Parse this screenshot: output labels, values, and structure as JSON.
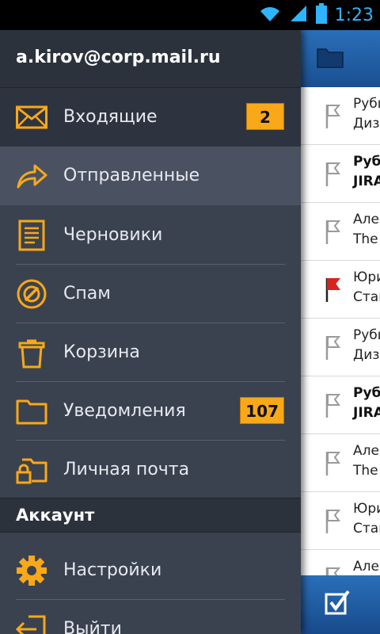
{
  "status_bar": {
    "time": "1:23",
    "icons": [
      "wifi-icon",
      "signal-icon",
      "battery-icon"
    ]
  },
  "drawer": {
    "account_email": "a.kirov@corp.mail.ru",
    "items": [
      {
        "label": "Входящие",
        "badge": "2",
        "icon": "envelope-icon"
      },
      {
        "label": "Отправленные",
        "badge": "",
        "icon": "sent-arrow-icon"
      },
      {
        "label": "Черновики",
        "badge": "",
        "icon": "document-icon"
      },
      {
        "label": "Спам",
        "badge": "",
        "icon": "spam-icon"
      },
      {
        "label": "Корзина",
        "badge": "",
        "icon": "trash-icon"
      },
      {
        "label": "Уведомления",
        "badge": "107",
        "icon": "folder-icon"
      },
      {
        "label": "Личная почта",
        "badge": "",
        "icon": "locked-folder-icon"
      }
    ],
    "section_title": "Аккаунт",
    "account_items": [
      {
        "label": "Настройки",
        "icon": "gear-icon"
      },
      {
        "label": "Выйти",
        "icon": "logout-icon"
      }
    ]
  },
  "message_list": {
    "messages": [
      {
        "line1": "Рубц",
        "line2": "Дизa",
        "bold": false,
        "flagged": false
      },
      {
        "line1": "Рубц",
        "line2": "JIRA",
        "bold": true,
        "flagged": false
      },
      {
        "line1": "Алек",
        "line2": "The",
        "bold": false,
        "flagged": false
      },
      {
        "line1": "Юри",
        "line2": "Стан",
        "bold": false,
        "flagged": true
      },
      {
        "line1": "Рубц",
        "line2": "Дизa",
        "bold": false,
        "flagged": false
      },
      {
        "line1": "Рубц",
        "line2": "JIRA",
        "bold": true,
        "flagged": false
      },
      {
        "line1": "Алек",
        "line2": "The",
        "bold": false,
        "flagged": false
      },
      {
        "line1": "Юри",
        "line2": "Стан",
        "bold": false,
        "flagged": false
      },
      {
        "line1": "Алек",
        "line2": "",
        "bold": false,
        "flagged": false
      }
    ]
  },
  "colors": {
    "accent": "#f8a818",
    "drawer_bg": "#3a4250",
    "header_blue": "#1a4f92",
    "flag_red": "#d8221e",
    "time": "#2fb4ff"
  }
}
